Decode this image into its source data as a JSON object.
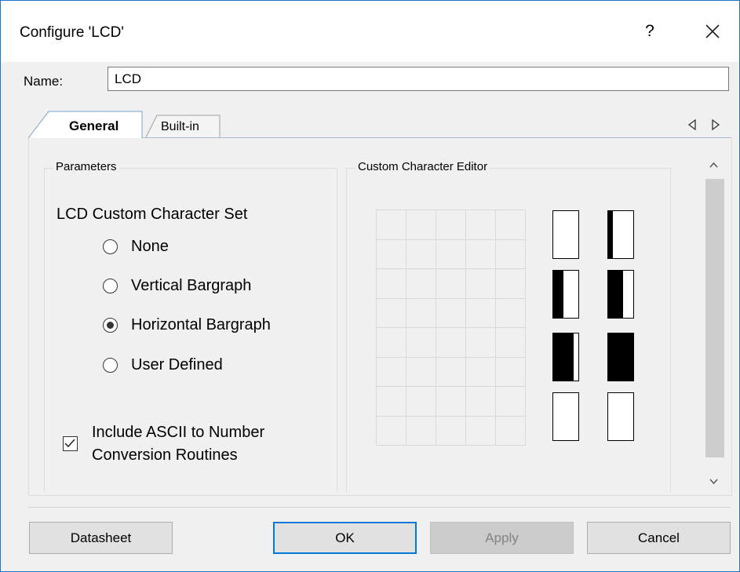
{
  "window": {
    "title": "Configure 'LCD'",
    "help_label": "?",
    "close_icon": "close-icon"
  },
  "name_field": {
    "label": "Name:",
    "value": "LCD"
  },
  "tabs": [
    {
      "label": "General",
      "active": true
    },
    {
      "label": "Built-in",
      "active": false
    }
  ],
  "tab_scroll": {
    "left_icon": "chevron-left-icon",
    "right_icon": "chevron-right-icon"
  },
  "parameters": {
    "group_title": "Parameters",
    "set_title": "LCD Custom Character Set",
    "options": [
      {
        "label": "None",
        "selected": false
      },
      {
        "label": "Vertical Bargraph",
        "selected": false
      },
      {
        "label": "Horizontal Bargraph",
        "selected": true
      },
      {
        "label": "User Defined",
        "selected": false
      }
    ],
    "include_ascii": {
      "checked": true,
      "label_line1": "Include ASCII to Number",
      "label_line2": "Conversion Routines"
    }
  },
  "editor": {
    "group_title": "Custom Character Editor",
    "grid_columns": 5,
    "grid_rows": 8,
    "previews_fill_fraction": [
      0,
      0.2,
      0.4,
      0.6,
      0.8,
      1.0,
      0,
      0
    ]
  },
  "buttons": {
    "datasheet": "Datasheet",
    "ok": "OK",
    "apply": "Apply",
    "cancel": "Cancel"
  },
  "colors": {
    "accent": "#0078d7",
    "border": "#1f74c8"
  }
}
